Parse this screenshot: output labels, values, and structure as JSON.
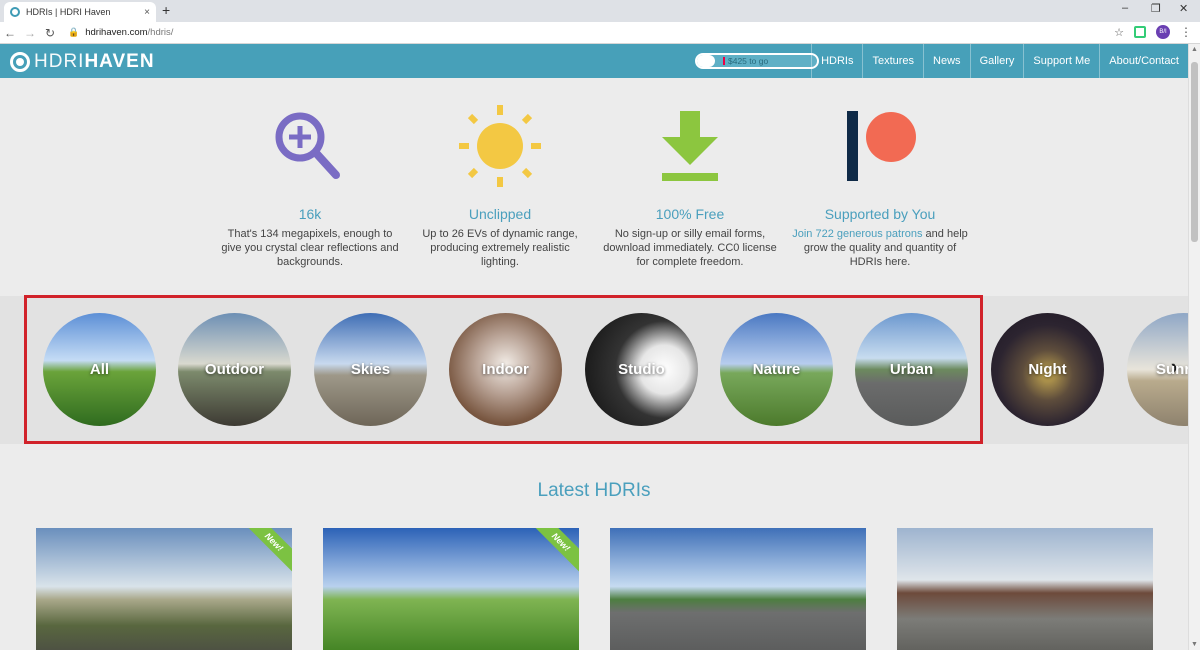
{
  "browser": {
    "tab_title": "HDRIs | HDRI Haven",
    "tab_close": "×",
    "new_tab": "+",
    "url_domain": "hdrihaven.com",
    "url_path": "/hdris/",
    "avatar_initials": "B/I",
    "window_controls": [
      "–",
      "❐",
      "✕"
    ]
  },
  "header": {
    "logo_thin": "HDRI",
    "logo_bold": "HAVEN",
    "goal_text": "$425 to go",
    "goal_progress": 0.15,
    "nav": [
      "HDRIs",
      "Textures",
      "News",
      "Gallery",
      "Support Me",
      "About/Contact"
    ]
  },
  "features": [
    {
      "title": "16k",
      "text": "That's 134 megapixels, enough to give you crystal clear reflections and backgrounds."
    },
    {
      "title": "Unclipped",
      "text": "Up to 26 EVs of dynamic range, producing extremely realistic lighting."
    },
    {
      "title": "100% Free",
      "text": "No sign-up or silly email forms, download immediately. CC0 license for complete freedom."
    },
    {
      "title": "Supported by You",
      "link": "Join 722 generous patrons",
      "text_after": " and help grow the quality and quantity of HDRIs here."
    }
  ],
  "categories": [
    "All",
    "Outdoor",
    "Skies",
    "Indoor",
    "Studio",
    "Nature",
    "Urban",
    "Night",
    "Sunrise"
  ],
  "latest": {
    "title": "Latest HDRIs",
    "new_badge": "New!"
  },
  "colors": {
    "brand": "#47a0b9",
    "accent_text": "#4a9fbd",
    "highlight": "#d1222a",
    "new_badge": "#7cc242"
  }
}
